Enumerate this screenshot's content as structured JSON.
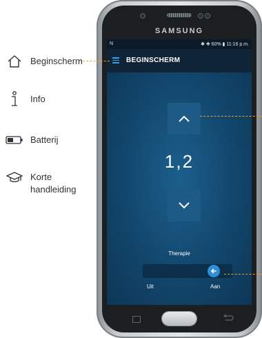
{
  "legend": [
    {
      "label": "Beginscherm",
      "icon": "home-icon"
    },
    {
      "label": "Info",
      "icon": "info-icon"
    },
    {
      "label": "Batterij",
      "icon": "battery-icon"
    },
    {
      "label": "Korte\nhandleiding",
      "icon": "graduation-cap-icon"
    }
  ],
  "phone": {
    "brand": "SAMSUNG",
    "status_left": "N",
    "status_right": "✱ ✚ 60% ▮ 11:16 p.m.",
    "app_title": "BEGINSCHERM",
    "value": "1,2",
    "therapy_label": "Therapie",
    "toggle_off_label": "Uit",
    "toggle_on_label": "Aan",
    "toggle_state": "on"
  },
  "colors": {
    "accent": "#2e8fd8",
    "callout": "#f0a030",
    "screen_bg": "#12466c"
  }
}
